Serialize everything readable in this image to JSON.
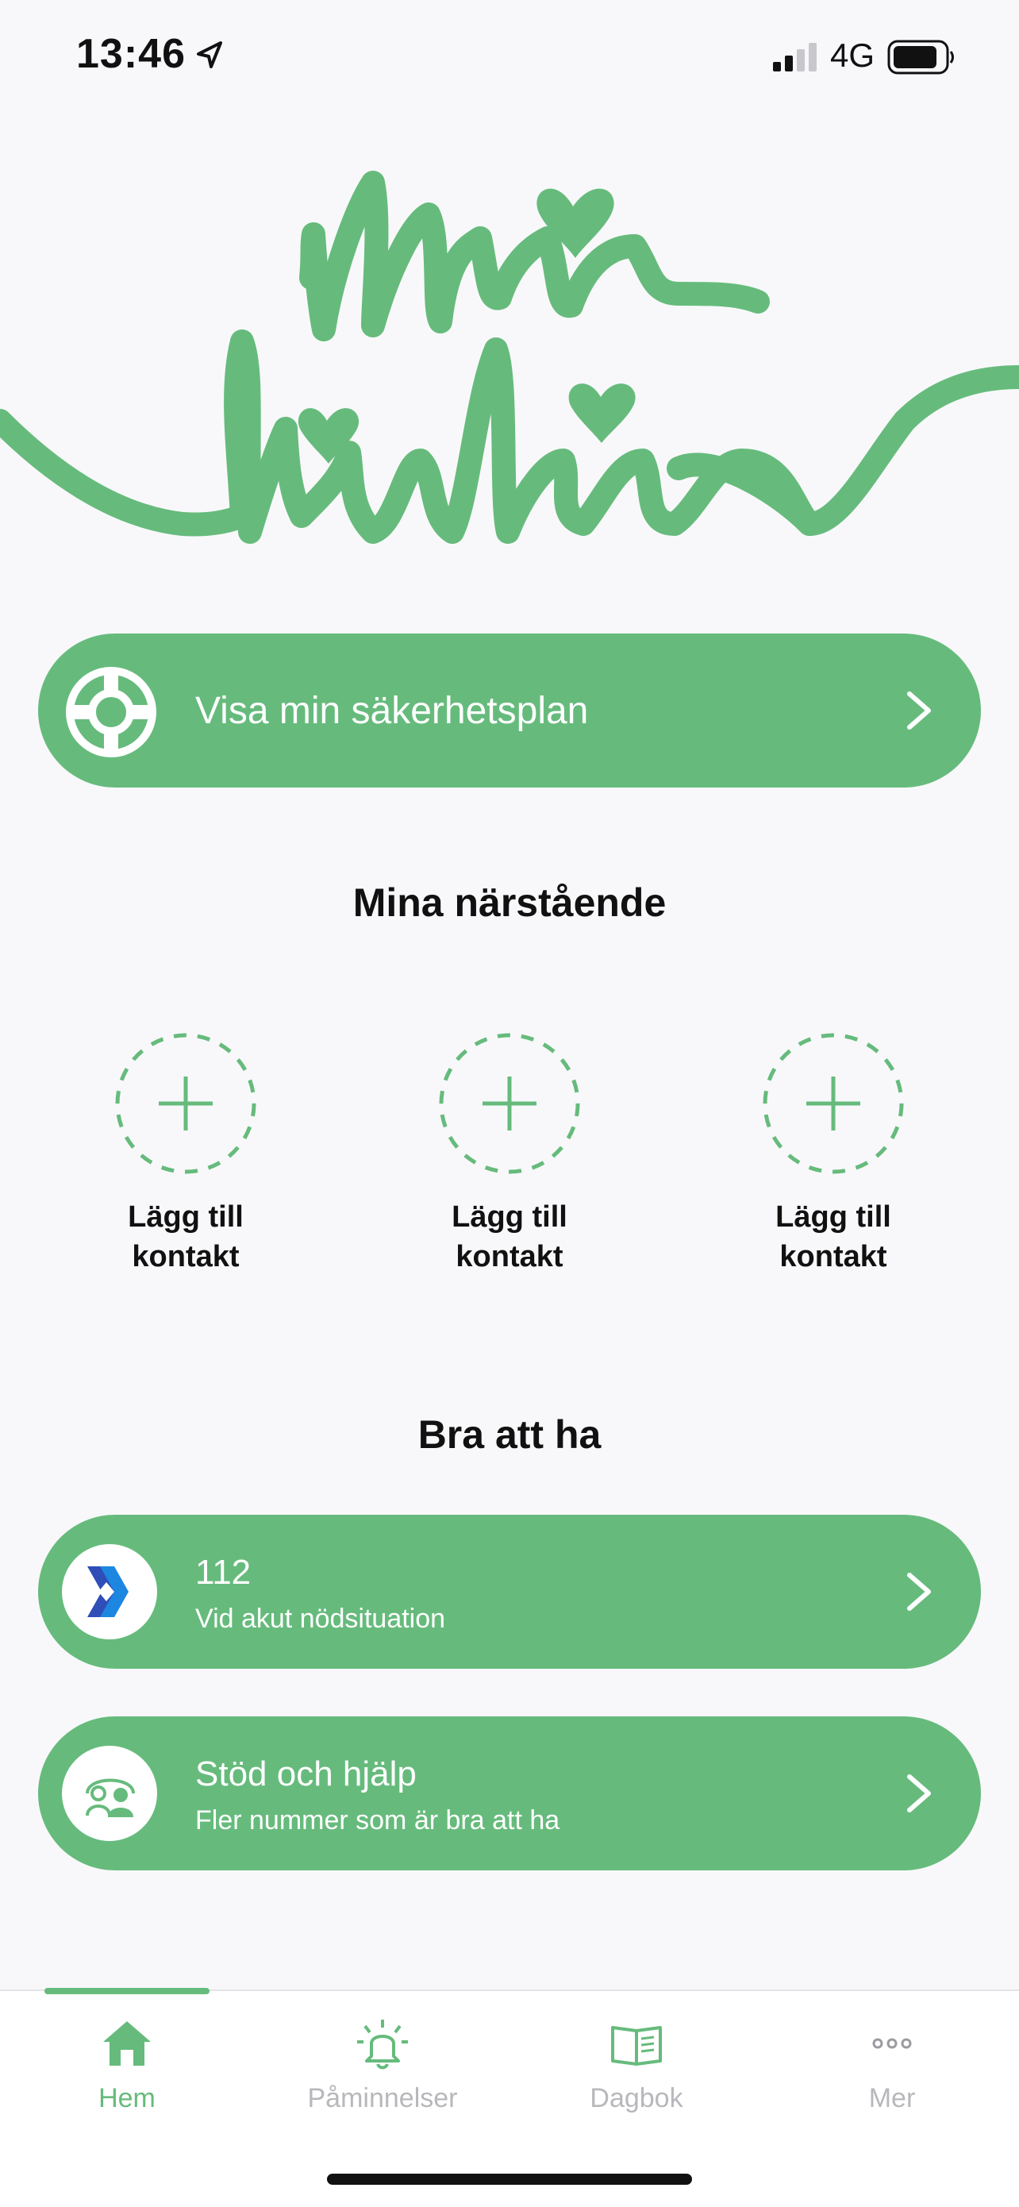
{
  "status_bar": {
    "time": "13:46",
    "network": "4G"
  },
  "logo": {
    "text": "Min livlina"
  },
  "safety_plan": {
    "label": "Visa min säkerhetsplan"
  },
  "contacts": {
    "heading": "Mina närstående",
    "items": [
      {
        "line1": "Lägg till",
        "line2": "kontakt"
      },
      {
        "line1": "Lägg till",
        "line2": "kontakt"
      },
      {
        "line1": "Lägg till",
        "line2": "kontakt"
      }
    ]
  },
  "good_to_have": {
    "heading": "Bra att ha",
    "items": [
      {
        "title": "112",
        "subtitle": "Vid akut nödsituation",
        "icon": "sos-alarm-icon"
      },
      {
        "title": "Stöd och hjälp",
        "subtitle": "Fler nummer som är bra att ha",
        "icon": "support-people-icon"
      }
    ]
  },
  "tabs": [
    {
      "label": "Hem",
      "icon": "home-icon",
      "active": true
    },
    {
      "label": "Påminnelser",
      "icon": "bell-icon",
      "active": false
    },
    {
      "label": "Dagbok",
      "icon": "book-icon",
      "active": false
    },
    {
      "label": "Mer",
      "icon": "more-icon",
      "active": false
    }
  ],
  "colors": {
    "accent": "#66bb7c",
    "background": "#f8f8fa",
    "inactive": "#b8b8bc"
  }
}
